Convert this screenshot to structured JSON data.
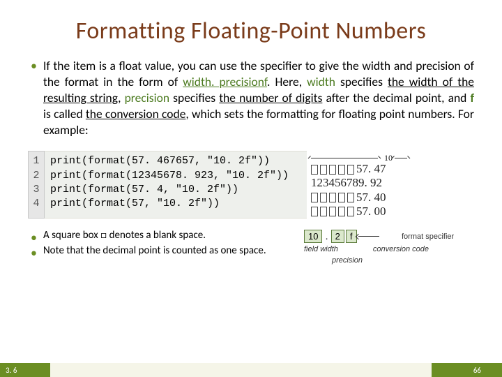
{
  "title": "Formatting Floating-Point Numbers",
  "para": {
    "p1": "If the item is a float value, you can use the specifier to give the width and precision of the format in the form of ",
    "fmt": "width. precisionf",
    "p2": ". Here, ",
    "kw1": "width",
    "p3": " specifies ",
    "u1": "the width of the resulting string",
    "p4": ", ",
    "kw2": "precision",
    "p5": " specifies ",
    "u2": "the number of digits",
    "p6": " after the decimal point, and ",
    "kw3": "f",
    "p7": " is called ",
    "u3": "the conversion code",
    "p8": ", which sets the formatting for floating point numbers. For example:"
  },
  "code": {
    "lines": [
      "1",
      "2",
      "3",
      "4"
    ],
    "rows": [
      "print(format(57. 467657, \"10. 2f\"))",
      "print(format(12345678. 923, \"10. 2f\"))",
      "print(format(57. 4, \"10. 2f\"))",
      "print(format(57, \"10. 2f\"))"
    ]
  },
  "output": {
    "width_label": "10",
    "rows": [
      {
        "blanks": 5,
        "text": "57. 47"
      },
      {
        "blanks": 0,
        "text": "123456789. 92"
      },
      {
        "blanks": 5,
        "text": "57. 40"
      },
      {
        "blanks": 5,
        "text": "57. 00"
      }
    ]
  },
  "notes": {
    "n1": "A square box □ denotes a blank space.",
    "n2": "Note that the decimal point is counted as one space."
  },
  "spec": {
    "label": "format specifier",
    "b1": "10",
    "dot": ".",
    "b2": "2",
    "b3": "f",
    "l1": "field width",
    "l2": "conversion code",
    "l3": "precision"
  },
  "footer": {
    "section": "3. 6",
    "page": "66"
  }
}
